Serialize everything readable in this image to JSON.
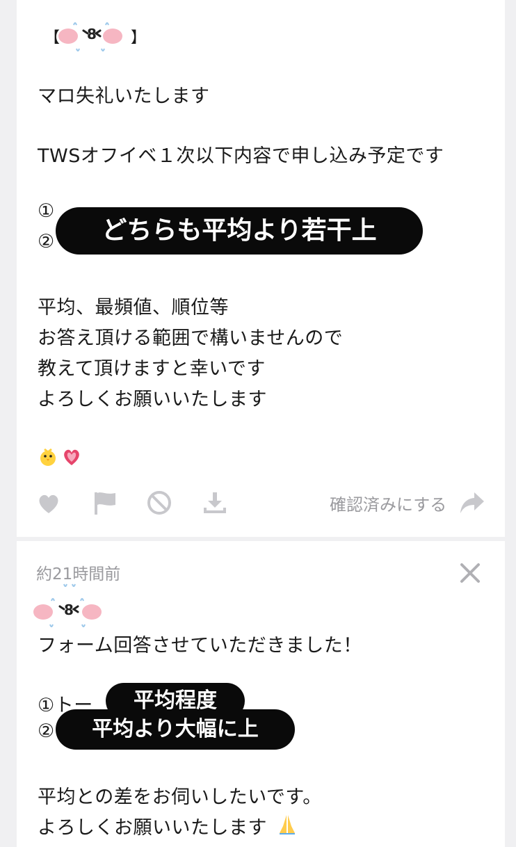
{
  "message1": {
    "bracket_open": "【",
    "bracket_close": "】",
    "lines": {
      "l1": "マロ失礼いたします",
      "l2": "TWSオフイベ１次以下内容で申し込み予定です",
      "l3": "①",
      "l4": "②",
      "l5": "平均、最頻値、順位等",
      "l6": "お答え頂ける範囲で構いませんので",
      "l7": "教えて頂けますと幸いです",
      "l8": "よろしくお願いいたします"
    },
    "overlay": "どちらも平均より若干上",
    "actions": {
      "confirm_label": "確認済みにする"
    }
  },
  "message2": {
    "timestamp": "約21時間前",
    "lines": {
      "l1": "フォーム回答させていただきました！",
      "l2": "①トー",
      "l3": "②",
      "l4": "平均との差をお伺いしたいです。",
      "l5": "よろしくお願いいたします"
    },
    "overlay_top": "平均程度",
    "overlay_bottom": "平均より大幅に上"
  },
  "colors": {
    "heart": "#e6456b",
    "overlay_bg": "#0a0a0a",
    "icon_gray": "#c8c8cc"
  }
}
